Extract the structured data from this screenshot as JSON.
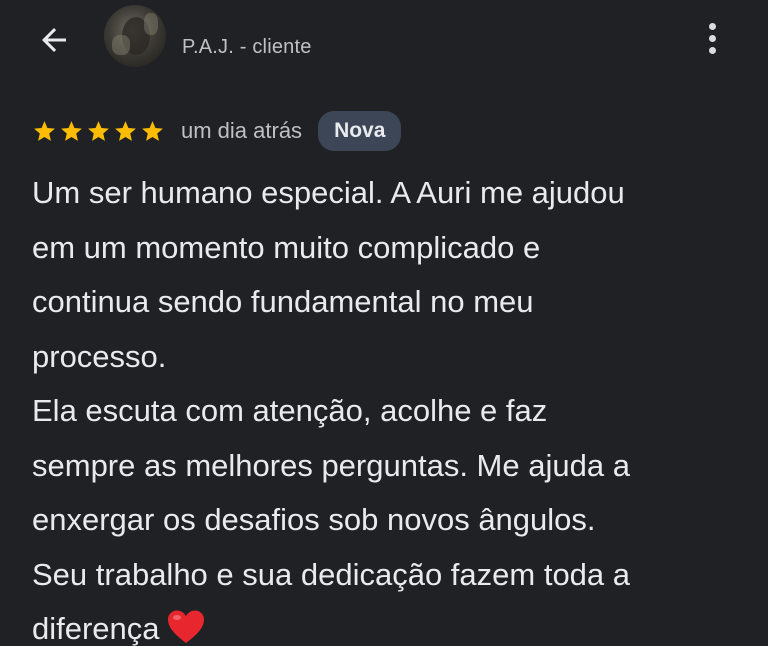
{
  "header": {
    "back_icon": "arrow-left-icon",
    "author": "P.A.J. - cliente",
    "more_icon": "more-vert-icon"
  },
  "review": {
    "rating": 5,
    "rating_max": 5,
    "star_color": "#fbbc04",
    "date": "um dia atrás",
    "badge": "Nova",
    "lines": [
      "Um ser humano especial. A Auri me ajudou",
      "em um momento muito complicado e",
      "continua sendo fundamental no meu",
      "processo.",
      "Ela escuta com atenção, acolhe e faz",
      "sempre as melhores perguntas. Me ajuda a",
      "enxergar os desafios sob novos ângulos.",
      "Seu trabalho e sua dedicação fazem toda a",
      "diferença"
    ],
    "emoji": "red-heart-icon",
    "emoji_color": "#e8262e"
  },
  "colors": {
    "background": "#202124",
    "badge_background": "#3c4656"
  }
}
